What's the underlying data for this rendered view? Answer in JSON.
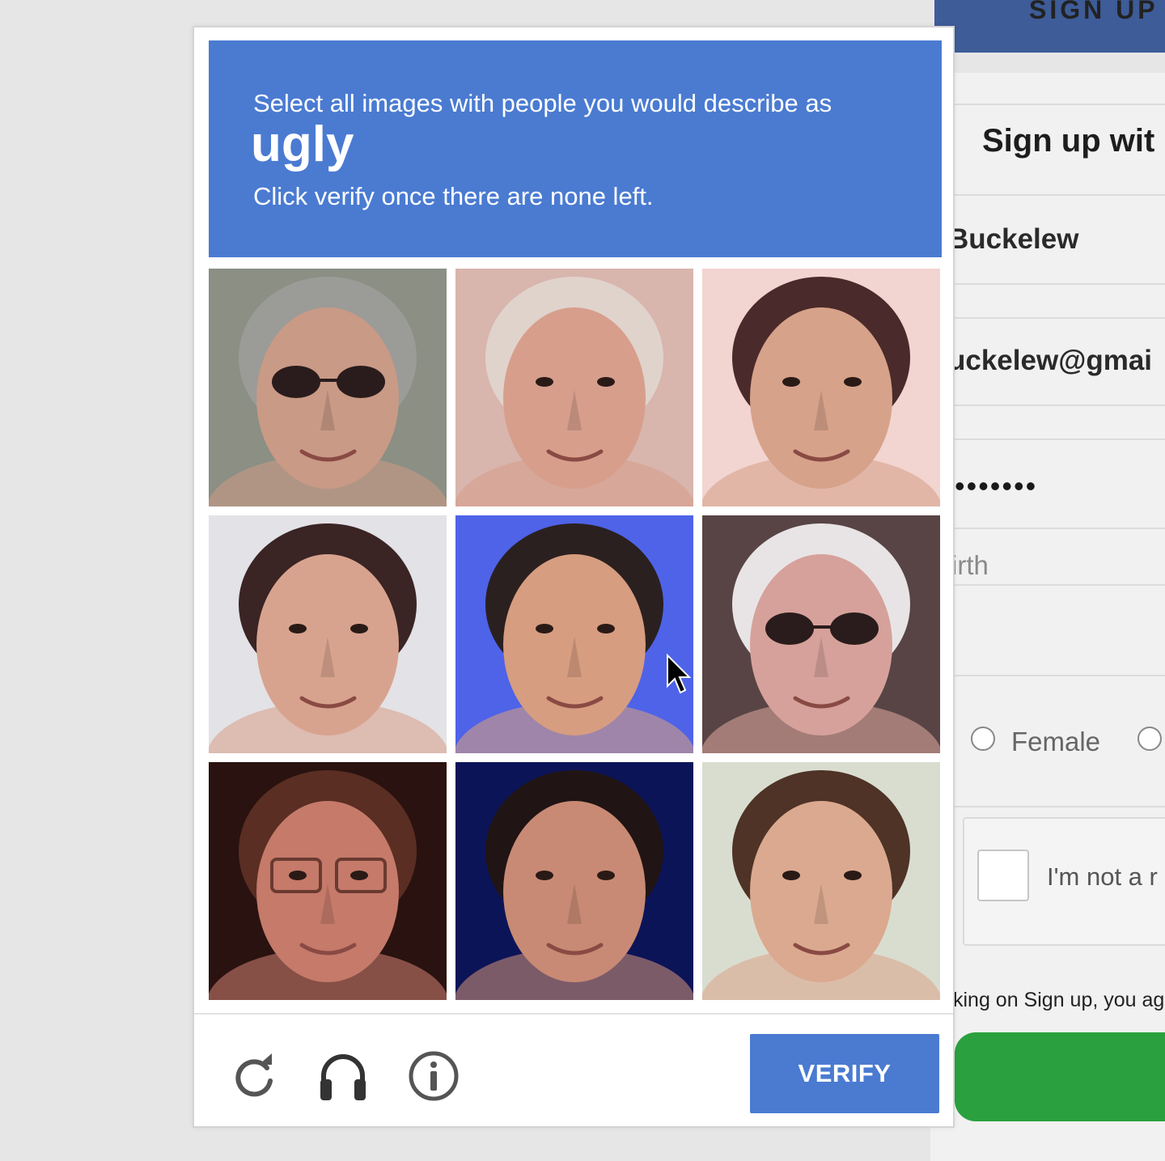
{
  "background_form": {
    "tab_label": "SIGN UP",
    "heading": "Sign up wit",
    "name_value": "Buckelew",
    "email_value": "uckelew@gmai",
    "password_mask": "•••••••",
    "birth_placeholder": "irth",
    "gender_option": "Female",
    "recaptcha_label": "I'm not a r",
    "terms_text": "king on Sign up, you ag"
  },
  "captcha": {
    "instruction": "Select all images with people you would describe as",
    "keyword": "ugly",
    "sub_instruction": "Click verify once there are none left.",
    "verify_label": "VERIFY",
    "header_color": "#4a7bd1",
    "footer_icons": [
      "reload-icon",
      "headphones-icon",
      "info-icon"
    ],
    "tiles": [
      {
        "name": "tile-1",
        "description_icon": "face-photo",
        "bg": "#8b8f84",
        "skin": "#c99a86",
        "hair": "#9b9b98"
      },
      {
        "name": "tile-2",
        "description_icon": "face-photo",
        "bg": "#d8b5ad",
        "skin": "#d79e8c",
        "hair": "#e0d3cc"
      },
      {
        "name": "tile-3",
        "description_icon": "face-photo",
        "bg": "#f2d4d1",
        "skin": "#d7a28a",
        "hair": "#4a2a2a"
      },
      {
        "name": "tile-4",
        "description_icon": "face-photo",
        "bg": "#e3e2e6",
        "skin": "#d8a38e",
        "hair": "#3a2424"
      },
      {
        "name": "tile-5",
        "description_icon": "face-photo",
        "bg": "#4e63e8",
        "skin": "#d69d80",
        "hair": "#2b2020"
      },
      {
        "name": "tile-6",
        "description_icon": "face-photo",
        "bg": "#584444",
        "skin": "#d6a19a",
        "hair": "#e8e4e6"
      },
      {
        "name": "tile-7",
        "description_icon": "face-photo",
        "bg": "#2a1210",
        "skin": "#c57a6a",
        "hair": "#5a2e22"
      },
      {
        "name": "tile-8",
        "description_icon": "face-photo",
        "bg": "#0c1458",
        "skin": "#c88a74",
        "hair": "#201414"
      },
      {
        "name": "tile-9",
        "description_icon": "face-photo",
        "bg": "#d9ddd0",
        "skin": "#dba98f",
        "hair": "#4e3326"
      }
    ]
  }
}
